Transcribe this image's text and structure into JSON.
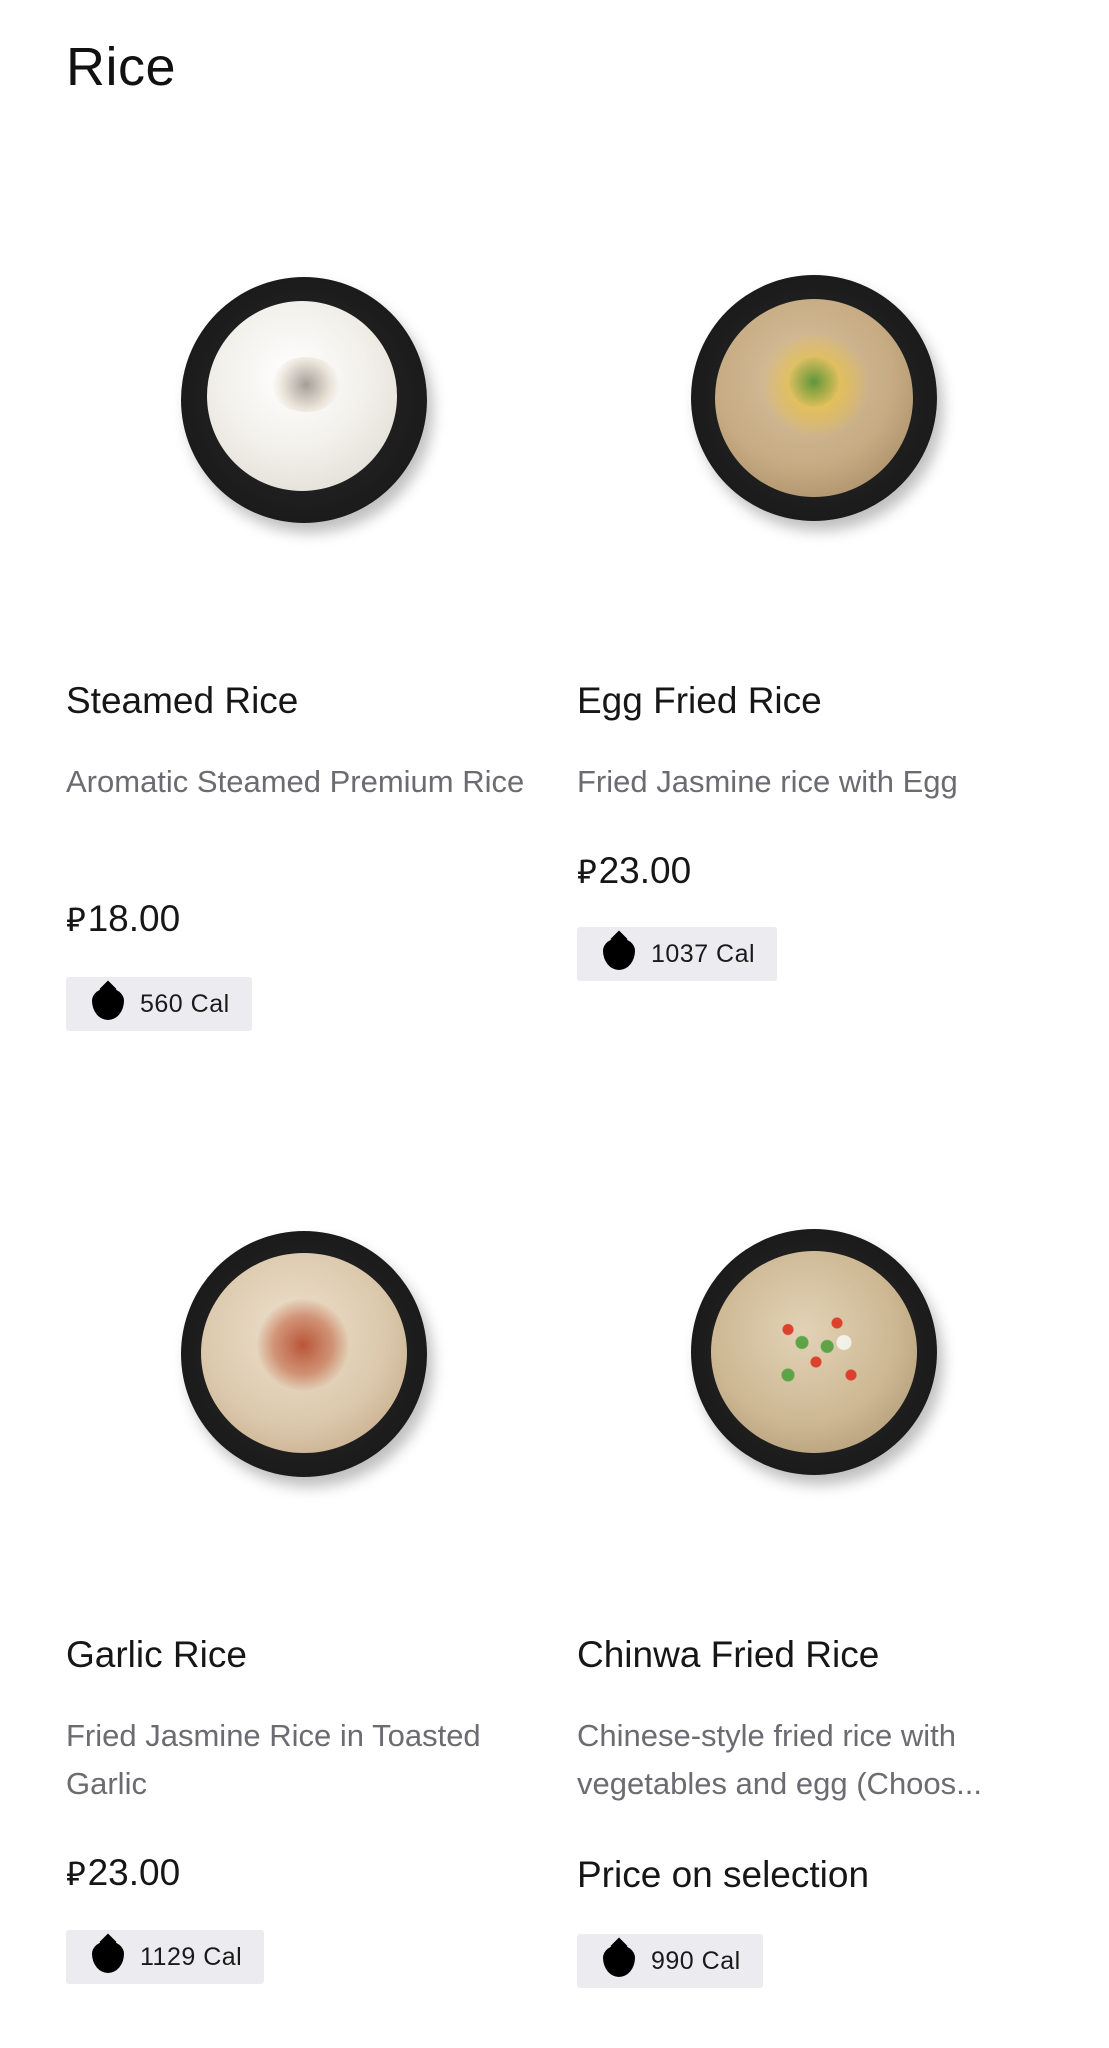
{
  "section": {
    "title": "Rice"
  },
  "items": [
    {
      "name": "Steamed Rice",
      "description": "Aromatic Steamed Premium Rice",
      "currency_symbol": "⃁",
      "price": "18.00",
      "calories": "560 Cal",
      "image": "steamed-rice-bowl"
    },
    {
      "name": "Egg Fried Rice",
      "description": "Fried Jasmine rice with Egg",
      "currency_symbol": "⃁",
      "price": "23.00",
      "calories": "1037 Cal",
      "image": "egg-fried-rice-bowl"
    },
    {
      "name": "Garlic Rice",
      "description": "Fried Jasmine Rice in Toasted Garlic",
      "currency_symbol": "⃁",
      "price": "23.00",
      "calories": "1129 Cal",
      "image": "garlic-rice-bowl"
    },
    {
      "name": "Chinwa Fried Rice",
      "description": "Chinese-style fried rice with vegetables and egg (Choos...",
      "price_text": "Price on selection",
      "calories": "990 Cal",
      "image": "chinwa-fried-rice-bowl"
    }
  ],
  "icons": {
    "calorie": "flame-drop-icon"
  },
  "colors": {
    "badge_bg": "#ececf0",
    "desc_text": "#6b6b72"
  }
}
